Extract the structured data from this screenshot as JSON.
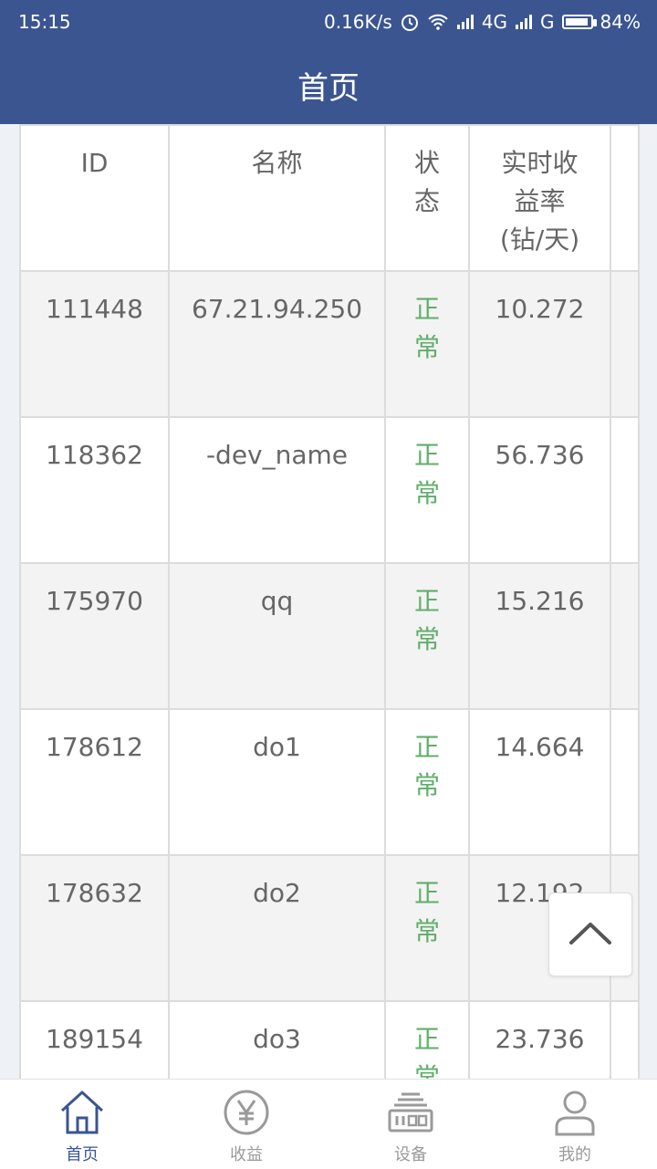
{
  "status_bar": {
    "time": "15:15",
    "network_speed": "0.16K/s",
    "signal1": "4G",
    "signal2": "G",
    "battery": "84%"
  },
  "header": {
    "title": "首页"
  },
  "table": {
    "columns": [
      "ID",
      "名称",
      "状态",
      "实时收益率(钻/天)"
    ],
    "rows": [
      {
        "id": "111448",
        "name": "67.21.94.250",
        "status": "正常",
        "rate": "10.272"
      },
      {
        "id": "118362",
        "name": "-dev_name",
        "status": "正常",
        "rate": "56.736"
      },
      {
        "id": "175970",
        "name": "qq",
        "status": "正常",
        "rate": "15.216"
      },
      {
        "id": "178612",
        "name": "do1",
        "status": "正常",
        "rate": "14.664"
      },
      {
        "id": "178632",
        "name": "do2",
        "status": "正常",
        "rate": "12.192"
      },
      {
        "id": "189154",
        "name": "do3",
        "status": "正常",
        "rate": "23.736"
      }
    ]
  },
  "bottom_nav": [
    {
      "label": "首页",
      "icon": "home-icon",
      "active": true
    },
    {
      "label": "收益",
      "icon": "yen-icon",
      "active": false
    },
    {
      "label": "设备",
      "icon": "device-icon",
      "active": false
    },
    {
      "label": "我的",
      "icon": "user-icon",
      "active": false
    }
  ],
  "colors": {
    "primary": "#3b5590",
    "status_ok": "#5fae6a",
    "text": "#666666",
    "inactive": "#9a9a9a"
  }
}
